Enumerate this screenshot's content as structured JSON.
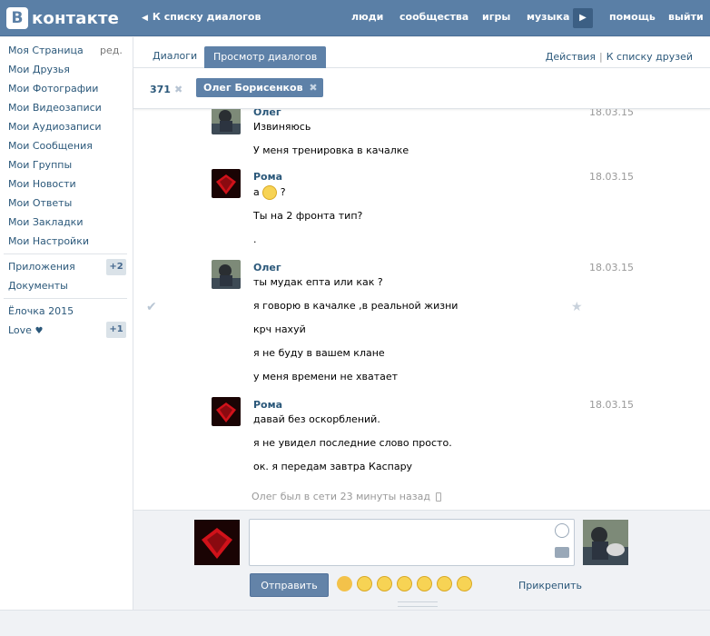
{
  "header": {
    "logo_letter": "В",
    "logo_text": "контакте",
    "back_label": "К списку диалогов",
    "nav": [
      "люди",
      "сообщества",
      "игры",
      "музыка",
      "помощь",
      "выйти"
    ]
  },
  "sidebar": {
    "edit_label": "ред.",
    "items": [
      "Моя Страница",
      "Мои Друзья",
      "Мои Фотографии",
      "Мои Видеозаписи",
      "Мои Аудиозаписи",
      "Мои Сообщения",
      "Мои Группы",
      "Мои Новости",
      "Мои Ответы",
      "Мои Закладки",
      "Мои Настройки"
    ],
    "apps_label": "Приложения",
    "apps_badge": "+2",
    "docs_label": "Документы",
    "game_label": "Ёлочка 2015",
    "love_label": "Love",
    "love_badge": "+1"
  },
  "tabs": {
    "dialogs": "Диалоги",
    "view": "Просмотр диалогов",
    "actions": "Действия",
    "to_friends": "К списку друзей"
  },
  "chips": {
    "count": "371",
    "active_name": "Олег Борисенков"
  },
  "messages": [
    {
      "author": "Олег",
      "date": "18.03.15",
      "lines": [
        "Извиняюсь",
        "У меня тренировка в качалке"
      ]
    },
    {
      "author": "Рома",
      "date": "18.03.15",
      "lines": [
        "а",
        "?",
        "Ты на 2 фронта тип?",
        "."
      ]
    },
    {
      "author": "Олег",
      "date": "18.03.15",
      "lines": [
        "ты мудак епта или как ?",
        "я говорю в качалке ,в реальной жизни",
        "крч нахуй",
        "я не буду в вашем клане",
        "у меня времени не хватает"
      ]
    },
    {
      "author": "Рома",
      "date": "18.03.15",
      "lines": [
        "давай без оскорблений.",
        "я не увидел последние слово просто.",
        "ок. я передам завтра Каспару"
      ]
    }
  ],
  "status": {
    "online": "Олег был в сети 23 минуты назад"
  },
  "composer": {
    "send_label": "Отправить",
    "attach_label": "Прикрепить"
  },
  "colors": {
    "header": "#5a7fa6",
    "link": "#2b587a",
    "button": "#6383a8"
  }
}
